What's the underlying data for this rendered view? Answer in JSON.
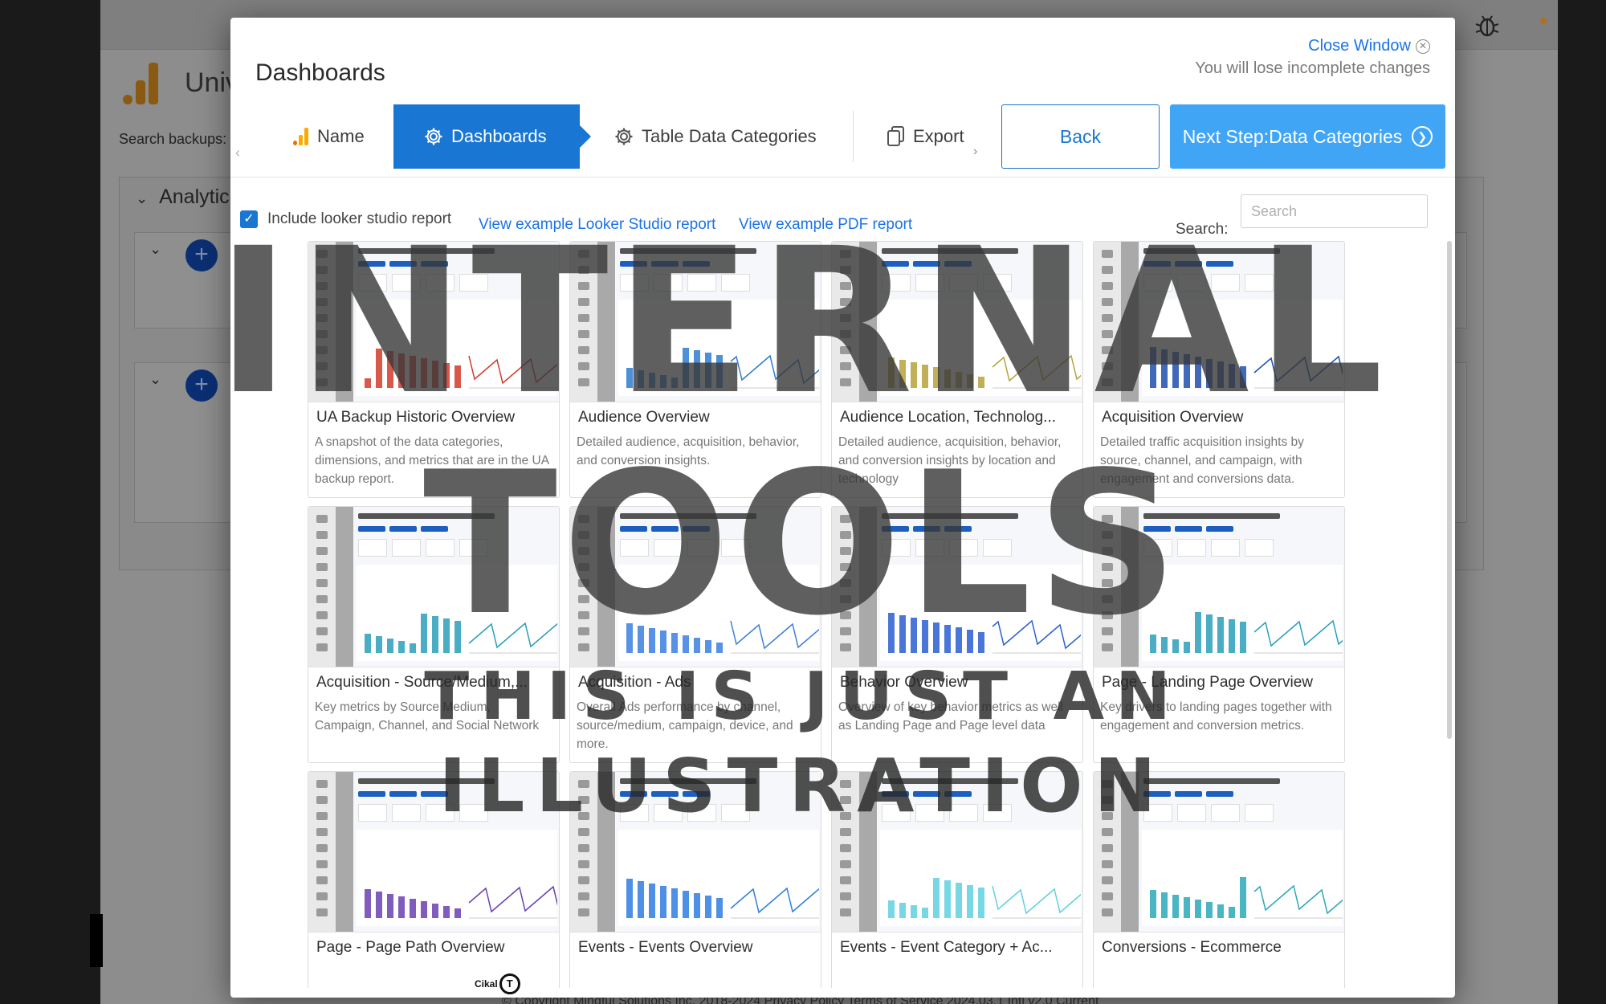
{
  "background": {
    "app_title": "Univ",
    "search_label": "Search backups:",
    "panel_label": "Analytic",
    "footer_text": "© Copyright Mindful Solutions Inc. 2018-2024 Privacy Policy Terms of Service 2024.03.1 Intl v2.0 Current"
  },
  "modal": {
    "title": "Dashboards",
    "close_label": "Close Window",
    "close_warning": "You will lose incomplete changes",
    "steps": [
      {
        "label": "Name",
        "icon": "google-analytics-icon",
        "active": false
      },
      {
        "label": "Dashboards",
        "icon": "gear-icon",
        "active": true
      },
      {
        "label": "Table Data Categories",
        "icon": "gear-icon",
        "active": false
      },
      {
        "label": "Export",
        "icon": "copy-icon",
        "active": false
      }
    ],
    "back_label": "Back",
    "next_label": "Next Step:Data Categories",
    "include_label": "Include looker studio report",
    "include_checked": true,
    "link_looker": "View example Looker Studio report",
    "link_pdf": "View example PDF report",
    "search_label": "Search:",
    "search_placeholder": "Search",
    "search_value": ""
  },
  "cards": [
    {
      "title": "UA Backup Historic Overview",
      "desc": "A snapshot of the data categories, dimensions, and metrics that are in the UA backup report.",
      "thumb_title": "Universal Analytics Backup: Historic Overview"
    },
    {
      "title": "Audience Overview",
      "desc": "Detailed audience, acquisition, behavior, and conversion insights.",
      "thumb_title": "Universal Analytics Backup: Audience Overview"
    },
    {
      "title": "Audience Location, Technolog...",
      "desc": "Detailed audience, acquisition, behavior, and conversion insights by location and technology",
      "thumb_title": "Audience Location Report"
    },
    {
      "title": "Acquisition Overview",
      "desc": "Detailed traffic acquisition insights by source, channel, and campaign, with engagement and conversions data.",
      "thumb_title": "Universal Analytics Backup: Acquisition Overview"
    },
    {
      "title": "Acquisition - Source/Medium,...",
      "desc": "Key metrics by Source Medium, Campaign, Channel, and Social Network",
      "thumb_title": "Source/Medium Report"
    },
    {
      "title": "Acquisition - Ads",
      "desc": "Overall Ads performance by channel, source/medium, campaign, device, and more.",
      "thumb_title": "Ads Report"
    },
    {
      "title": "Behavior Overview",
      "desc": "Overview of key behavior metrics as well as Landing Page and Page level data",
      "thumb_title": "Universal Analytics Backup: Behavior Overview"
    },
    {
      "title": "Page - Landing Page Overview",
      "desc": "Key drivers to landing pages together with engagement and conversion metrics.",
      "thumb_title": "Landing Page Report"
    },
    {
      "title": "Page - Page Path Overview",
      "desc": "",
      "thumb_title": "Page Path Report"
    },
    {
      "title": "Events - Events Overview",
      "desc": "",
      "thumb_title": "Universal Analytics Backup: Events Overview"
    },
    {
      "title": "Events - Event Category + Ac...",
      "desc": "",
      "thumb_title": "Event Category Report"
    },
    {
      "title": "Conversions - Ecommerce",
      "desc": "",
      "thumb_title": "Ecommerce Detail Report"
    }
  ],
  "watermark": {
    "line1": "INTERNAL",
    "line2": "TOOLS",
    "line3": "THIS IS JUST AN",
    "line4": "ILLUSTRATION"
  },
  "corner_logo": {
    "text": "Cikal",
    "letter": "T"
  },
  "colors": {
    "primary": "#1976d2",
    "next_button": "#41a5f5",
    "link": "#1a73e8",
    "ga_orange": "#f9ab00",
    "ga_dark_orange": "#e37400"
  }
}
